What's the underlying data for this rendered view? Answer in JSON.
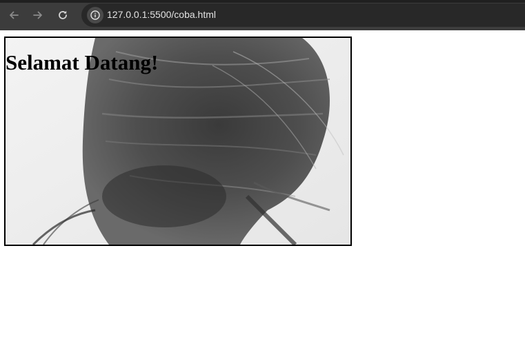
{
  "browser": {
    "url": "127.0.0.1:5500/coba.html",
    "icons": {
      "back": "arrow-left-icon",
      "forward": "arrow-right-icon",
      "reload": "reload-icon",
      "site_info": "info-icon"
    },
    "colors": {
      "toolbar": "#3c3c3c",
      "address_bar": "#282828",
      "url_text": "#e3e3e3"
    }
  },
  "page": {
    "heading": "Selamat Datang!",
    "hero_image": "black-and-white photo of windswept hair",
    "colors": {
      "background": "#ffffff",
      "hero_border": "#000000",
      "heading_text": "#000000"
    }
  }
}
